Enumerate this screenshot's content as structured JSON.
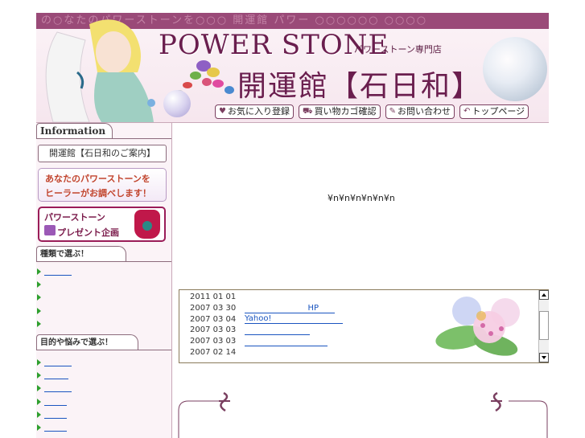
{
  "header": {
    "strip_text": "の○なたのパワーストーンを○○○ 開運館 パワー ○○○○○○ ○○○○",
    "logo_en": "POWER STONE",
    "logo_sub": "パワーストーン専門店",
    "logo_ja": "開運館【石日和】",
    "nav": [
      {
        "icon": "heart-icon",
        "label": "お気に入り登録"
      },
      {
        "icon": "cart-icon",
        "label": "買い物カゴ確認"
      },
      {
        "icon": "pencil-icon",
        "label": "お問い合わせ"
      },
      {
        "icon": "return-icon",
        "label": "トップページ"
      }
    ]
  },
  "sidebar": {
    "info_heading": "Information",
    "guide_button": "開運館【石日和のご案内】",
    "banner_healer": {
      "line1": "あなたのパワーストーンを",
      "line2": "ヒーラーがお調べします！"
    },
    "banner_gift": {
      "line1": "パワーストーン",
      "line2": "プレゼント企画"
    },
    "type_heading": "種類で選ぶ！",
    "purpose_heading": "目的や悩みで選ぶ！"
  },
  "main": {
    "garbled_text": "¥n¥n¥n¥n¥n¥n",
    "news": [
      {
        "date": "2011 01 01",
        "text": ""
      },
      {
        "date": "2007 03 30",
        "text": "HP"
      },
      {
        "date": "2007 03 04",
        "text": "Yahoo!"
      },
      {
        "date": "2007 03 03",
        "text": ""
      },
      {
        "date": "2007 03 03",
        "text": ""
      },
      {
        "date": "2007 02 14",
        "text": ""
      }
    ]
  },
  "colors": {
    "brand": "#6a1e4e",
    "link": "#1a55c0",
    "bullet": "#2ea02e"
  }
}
